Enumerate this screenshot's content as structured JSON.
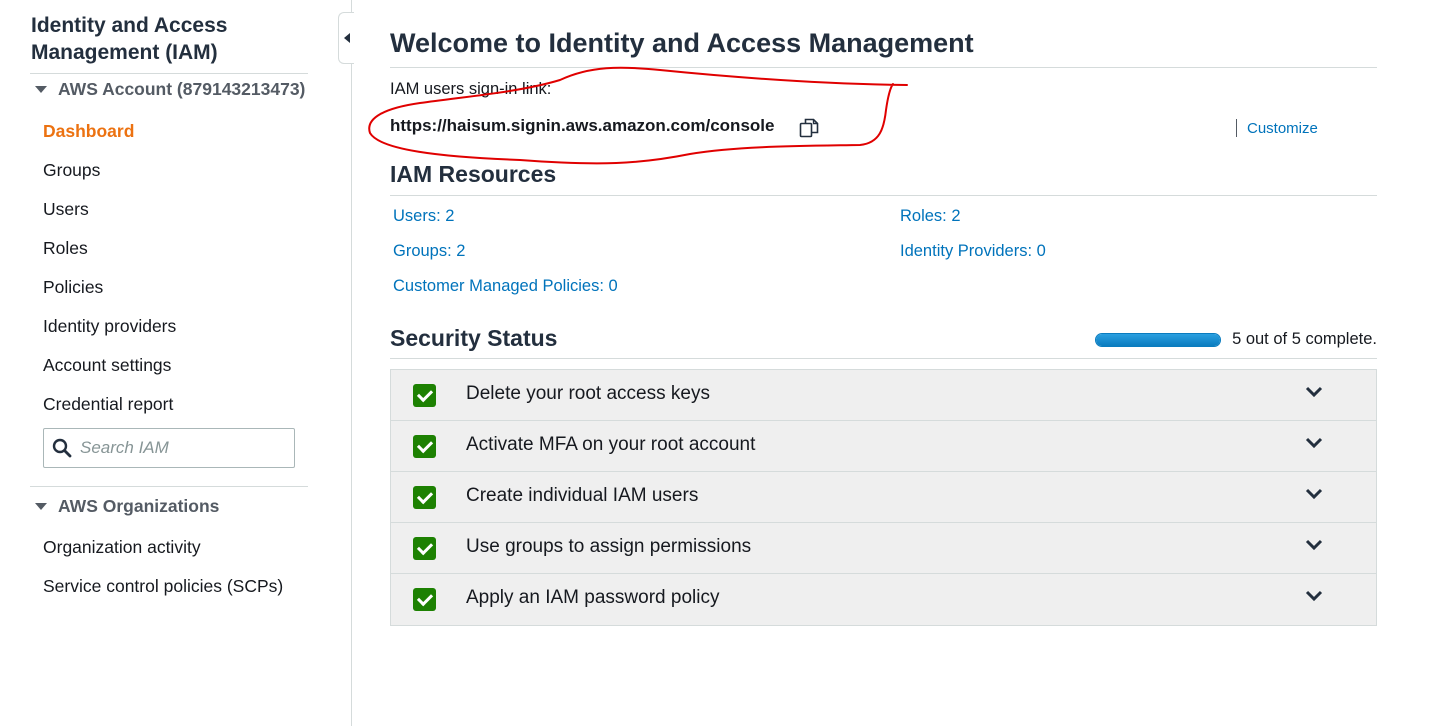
{
  "sidebar": {
    "title": "Identity and Access Management (IAM)",
    "account_section": "AWS Account (879143213473)",
    "nav": [
      {
        "label": "Dashboard",
        "active": true
      },
      {
        "label": "Groups"
      },
      {
        "label": "Users"
      },
      {
        "label": "Roles"
      },
      {
        "label": "Policies"
      },
      {
        "label": "Identity providers"
      },
      {
        "label": "Account settings"
      },
      {
        "label": "Credential report"
      }
    ],
    "search_placeholder": "Search IAM",
    "org_section": "AWS Organizations",
    "org_nav": [
      {
        "label": "Organization activity"
      },
      {
        "label": "Service control policies (SCPs)"
      }
    ]
  },
  "main": {
    "title": "Welcome to Identity and Access Management",
    "signin_label": "IAM users sign-in link:",
    "signin_url": "https://haisum.signin.aws.amazon.com/console",
    "customize_label": "Customize",
    "resources_title": "IAM Resources",
    "resources": {
      "users": "Users: 2",
      "roles": "Roles: 2",
      "groups": "Groups: 2",
      "identity_providers": "Identity Providers: 0",
      "customer_managed_policies": "Customer Managed Policies: 0"
    },
    "security_title": "Security Status",
    "progress": {
      "completed": 5,
      "total": 5,
      "text": "5 out of 5 complete."
    },
    "security_items": [
      {
        "label": "Delete your root access keys",
        "done": true
      },
      {
        "label": "Activate MFA on your root account",
        "done": true
      },
      {
        "label": "Create individual IAM users",
        "done": true
      },
      {
        "label": "Use groups to assign permissions",
        "done": true
      },
      {
        "label": "Apply an IAM password policy",
        "done": true
      }
    ]
  },
  "colors": {
    "active_nav": "#ec7211",
    "link": "#0073bb",
    "check": "#1d8102",
    "progress": "#0a7cbf",
    "annotation": "#e00000"
  }
}
